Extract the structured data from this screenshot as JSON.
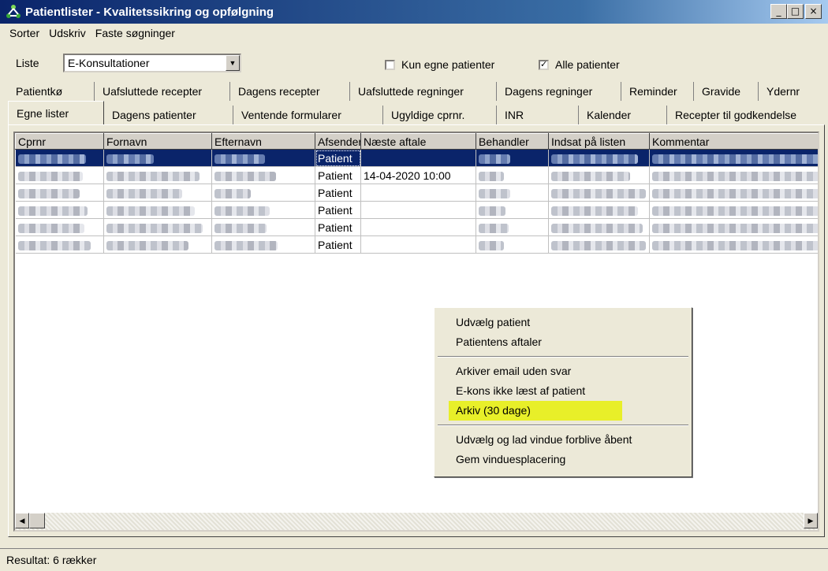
{
  "window": {
    "title": "Patientlister - Kvalitetssikring og opfølgning",
    "buttons": {
      "minimize": "_",
      "maximize": "□",
      "close": "×"
    }
  },
  "menu": [
    "Sorter",
    "Udskriv",
    "Faste søgninger"
  ],
  "filters": {
    "liste_label": "Liste",
    "liste_value": "E-Konsultationer",
    "kun_egne": {
      "label": "Kun egne patienter",
      "checked": false
    },
    "alle": {
      "label": "Alle patienter",
      "checked": true
    }
  },
  "tabs_top": [
    "Patientkø",
    "Uafsluttede recepter",
    "Dagens recepter",
    "Uafsluttede regninger",
    "Dagens regninger",
    "Reminder",
    "Gravide",
    "Ydernr"
  ],
  "tabs_bottom": [
    "Egne lister",
    "Dagens patienter",
    "Ventende formularer",
    "Ugyldige cprnr.",
    "INR",
    "Kalender",
    "Recepter til godkendelse"
  ],
  "grid": {
    "columns": [
      "Cprnr",
      "Fornavn",
      "Efternavn",
      "Afsender",
      "Næste aftale",
      "Behandler",
      "Indsat på listen",
      "Kommentar"
    ],
    "rows": [
      {
        "afsender": "Patient",
        "aftale": "",
        "kommentar_tail": "er om d"
      },
      {
        "afsender": "Patient",
        "aftale": "14-04-2020 10:00",
        "kommentar_tail": "r du de"
      },
      {
        "afsender": "Patient",
        "aftale": "",
        "kommentar_tail": "n tid til m"
      },
      {
        "afsender": "Patient",
        "aftale": "",
        "kommentar_tail": "hge væ"
      },
      {
        "afsender": "Patient",
        "aftale": "",
        "kommentar_tail": "ide et n"
      },
      {
        "afsender": "Patient",
        "aftale": "",
        "kommentar_tail": "det sidst"
      }
    ]
  },
  "context_menu": {
    "group1": [
      "Udvælg patient",
      "Patientens aftaler"
    ],
    "group2": [
      "Arkiver email uden svar",
      "E-kons ikke læst af patient",
      "Arkiv  (30 dage)"
    ],
    "group3": [
      "Udvælg og lad vindue forblive åbent",
      "Gem vinduesplacering"
    ],
    "highlight_color": "#e8ef29"
  },
  "status": "Resultat: 6 rækker",
  "colors": {
    "titlebar": "#0a246a",
    "selection": "#0a246a",
    "face": "#ece9d8"
  }
}
